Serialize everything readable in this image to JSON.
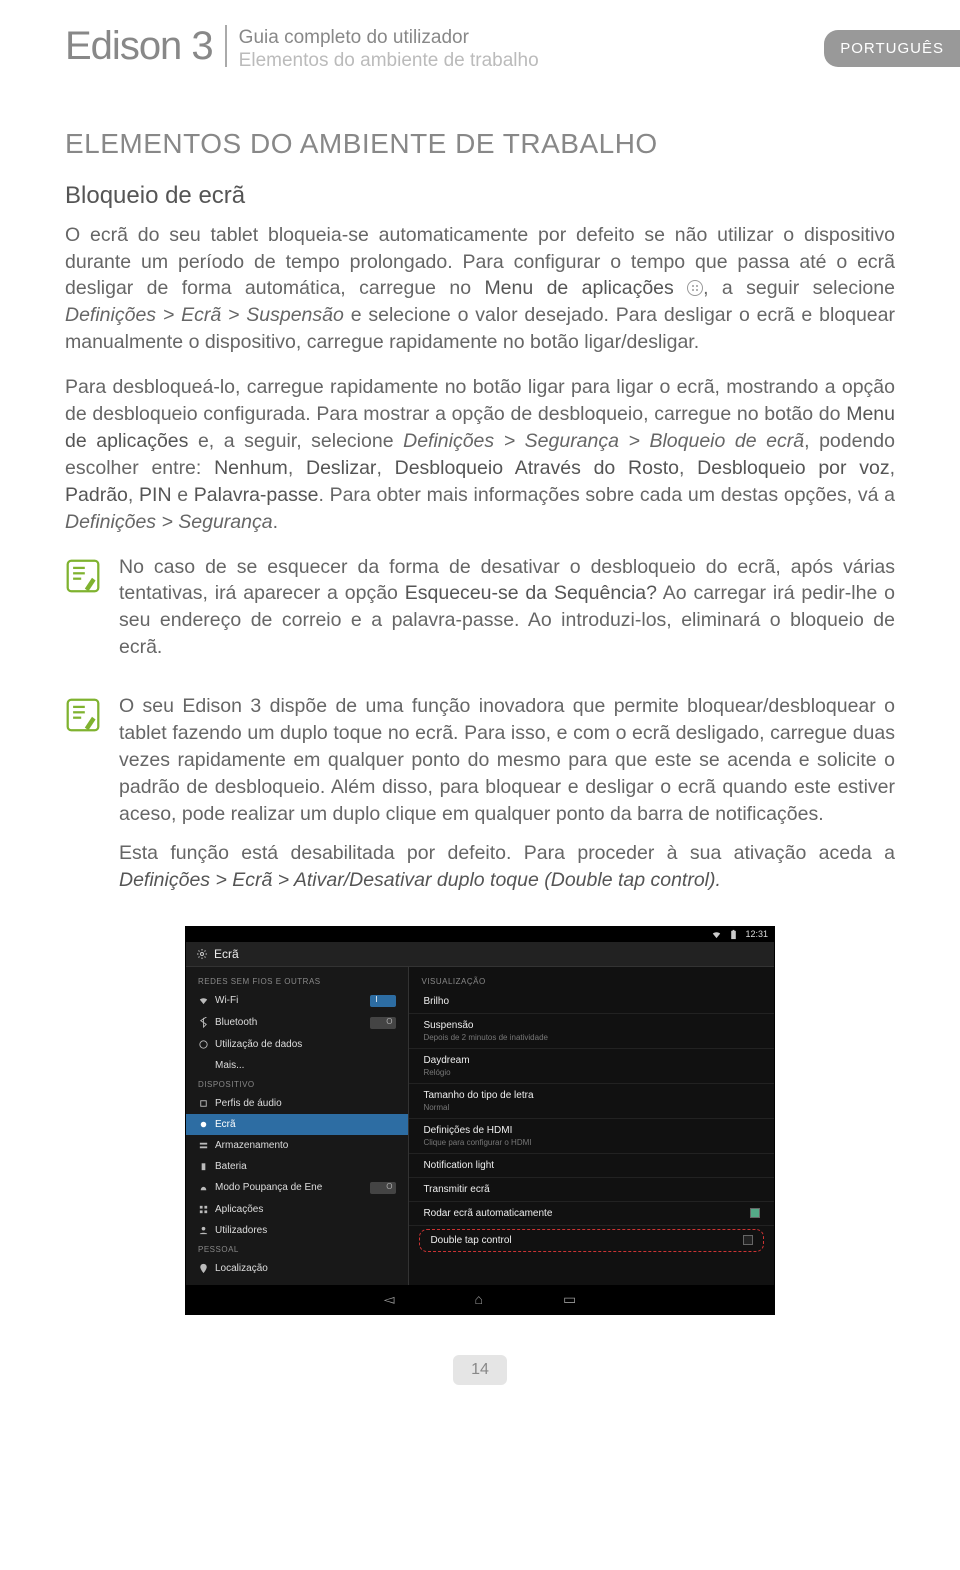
{
  "header": {
    "brand": "Edison 3",
    "line1": "Guia completo do utilizador",
    "line2": "Elementos do ambiente de trabalho",
    "lang": "PORTUGUÊS"
  },
  "section_title": "ELEMENTOS DO AMBIENTE DE TRABALHO",
  "sub_title": "Bloqueio de ecrã",
  "para1_a": "O ecrã do seu tablet bloqueia-se automaticamente por defeito se não utilizar o dispositivo durante um período de tempo prolongado. Para configurar o tempo que passa até o ecrã desligar de forma automática, carregue no ",
  "para1_b": "Menu de aplicações",
  "para1_c": ", a seguir selecione ",
  "para1_d": "Definições > Ecrã > Suspensão",
  "para1_e": " e selecione o valor desejado. Para desligar o ecrã e bloquear manualmente o dispositivo, carregue rapidamente no botão ligar/desligar.",
  "para2_a": "Para desbloqueá-lo, carregue rapidamente no botão ligar para ligar o ecrã, mostrando a opção de desbloqueio configurada. Para mostrar a opção de desbloqueio, carregue no botão do ",
  "para2_b": "Menu de aplicações",
  "para2_c": " e, a seguir, selecione ",
  "para2_d": "Definições > Segurança > Bloqueio de ecrã",
  "para2_e": ", podendo escolher entre: ",
  "para2_f": "Nenhum",
  "para2_g": "Deslizar",
  "para2_h": "Desbloqueio Através do Rosto",
  "para2_i": "Desbloqueio por voz",
  "para2_j": "Padrão",
  "para2_k": "PIN",
  "para2_l": "Palavra-passe",
  "para2_m": ". Para obter mais informações sobre cada um destas opções, vá a ",
  "para2_n": "Definições > Segurança",
  "note1_a": "No caso de se esquecer da forma de desativar o desbloqueio do ecrã, após várias tentativas, irá aparecer a opção ",
  "note1_b": "Esqueceu-se da Sequência?",
  "note1_c": " Ao carregar irá pedir-lhe o seu endereço de correio e a palavra-passe. Ao introduzi-los, eliminará o bloqueio de ecrã.",
  "note2_p1": "O seu Edison 3 dispõe de uma função inovadora que permite bloquear/desbloquear o tablet fazendo um duplo toque no ecrã. Para isso, e com o ecrã desligado, carregue duas vezes rapidamente em qualquer ponto do mesmo para que este se acenda e solicite o padrão de desbloqueio. Além disso, para bloquear e desligar o ecrã quando este estiver aceso, pode realizar um duplo clique em qualquer ponto da barra de notificações.",
  "note2_p2_a": "Esta função está desabilitada por defeito. Para proceder à sua ativação aceda a ",
  "note2_p2_b": "Definições > Ecrã > Ativar/Desativar duplo toque (Double tap control).",
  "screenshot": {
    "status_time": "12:31",
    "title": "Ecrã",
    "left_head1": "REDES SEM FIOS E OUTRAS",
    "wifi": "Wi-Fi",
    "bt": "Bluetooth",
    "data": "Utilização de dados",
    "more": "Mais...",
    "left_head2": "DISPOSITIVO",
    "audio": "Perfis de áudio",
    "screen": "Ecrã",
    "storage": "Armazenamento",
    "battery": "Bateria",
    "eco": "Modo Poupança de Ene",
    "apps": "Aplicações",
    "users": "Utilizadores",
    "left_head3": "PESSOAL",
    "location": "Localização",
    "right_head": "VISUALIZAÇÃO",
    "bright": "Brilho",
    "susp_t": "Suspensão",
    "susp_s": "Depois de 2 minutos de inatividade",
    "day_t": "Daydream",
    "day_s": "Relógio",
    "font_t": "Tamanho do tipo de letra",
    "font_s": "Normal",
    "hdmi_t": "Definições de HDMI",
    "hdmi_s": "Clique para configurar o HDMI",
    "notif": "Notification light",
    "cast": "Transmitir ecrã",
    "rotate": "Rodar ecrã automaticamente",
    "dtc": "Double tap control"
  },
  "page_number": "14"
}
